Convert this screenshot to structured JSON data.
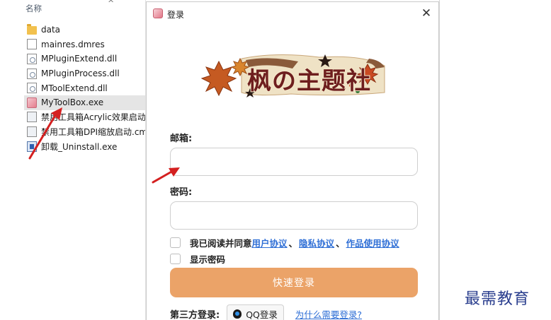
{
  "explorer": {
    "column_header": "名称",
    "files": [
      {
        "name": "data",
        "icon": "folder-icon"
      },
      {
        "name": "mainres.dmres",
        "icon": "file-icon"
      },
      {
        "name": "MPluginExtend.dll",
        "icon": "dll-file-icon"
      },
      {
        "name": "MPluginProcess.dll",
        "icon": "dll-file-icon"
      },
      {
        "name": "MToolExtend.dll",
        "icon": "dll-file-icon"
      },
      {
        "name": "MyToolBox.exe",
        "icon": "app-icon",
        "selected": true
      },
      {
        "name": "禁用工具箱Acrylic效果启动.c",
        "icon": "cmd-file-icon"
      },
      {
        "name": "禁用工具箱DPI缩放启动.cmd",
        "icon": "cmd-file-icon"
      },
      {
        "name": "卸载_Uninstall.exe",
        "icon": "uninstall-icon"
      }
    ]
  },
  "dialog": {
    "title": "登录",
    "logo_text": "枫の主题社",
    "email_label": "邮箱:",
    "email_value": "",
    "password_label": "密码:",
    "password_value": "",
    "agree_text": "我已阅读并同意",
    "user_agreement": "用户协议",
    "separator": "、",
    "privacy_agreement": "隐私协议",
    "works_agreement": "作品使用协议",
    "show_password": "显示密码",
    "login_button": "快速登录",
    "third_party_label": "第三方登录:",
    "qq_login": "QQ登录",
    "why_login": "为什么需要登录?"
  },
  "watermark": "最需教育",
  "colors": {
    "login_button": "#eba368",
    "link": "#2f6fd6",
    "arrow": "#d42020",
    "watermark": "#2a3e8e"
  }
}
